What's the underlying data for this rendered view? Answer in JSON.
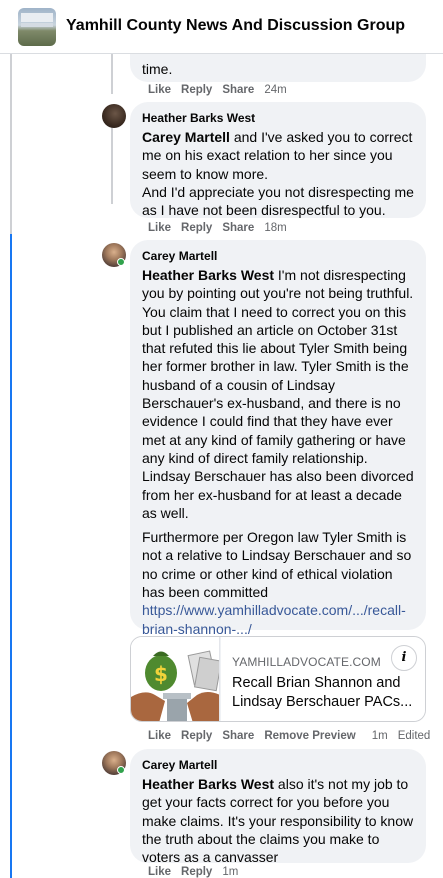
{
  "header": {
    "title": "Yamhill County News And Discussion Group"
  },
  "comments": [
    {
      "author": "",
      "text_tail": "time.",
      "actions": {
        "like": "Like",
        "reply": "Reply",
        "share": "Share",
        "time": "24m"
      }
    },
    {
      "author": "Heather Barks West",
      "mention": "Carey Martell",
      "text": " and I've asked you to correct me on his exact relation to her since you seem to know more.",
      "text2": "And I'd appreciate you not disrespecting me as I have not been disrespectful to you.",
      "actions": {
        "like": "Like",
        "reply": "Reply",
        "share": "Share",
        "time": "18m"
      }
    },
    {
      "author": "Carey Martell",
      "mention": "Heather Barks West",
      "text": " I'm not disrespecting you by pointing out you're not being truthful. You claim that I need to correct you on this but I published an article on October 31st that refuted this lie about Tyler Smith being her former brother in law. Tyler Smith is the husband of a cousin of Lindsay Berschauer's ex-husband, and there is no evidence I could find that they have ever met at any kind of family gathering or have any kind of direct family relationship. Lindsay Berschauer has also been divorced from her ex-husband for at least a decade as well.",
      "text2": "Furthermore per Oregon law Tyler Smith is not a relative to Lindsay Berschauer and so no crime or other kind of ethical violation has been committed",
      "link": "https://www.yamhilladvocate.com/.../recall-brian-shannon-.../",
      "preview": {
        "domain": "YAMHILLADVOCATE.COM",
        "title": "Recall Brian Shannon and Lindsay Berschauer PACs..."
      },
      "actions": {
        "like": "Like",
        "reply": "Reply",
        "share": "Share",
        "remove_preview": "Remove Preview",
        "time": "1m",
        "edited": "Edited"
      }
    },
    {
      "author": "Carey Martell",
      "mention": "Heather Barks West",
      "text": " also it's not my job to get your facts correct for you before you make claims. It's your responsibility to know the truth about the claims you make to voters as a canvasser",
      "actions": {
        "like": "Like",
        "reply": "Reply",
        "time": "1m"
      }
    }
  ],
  "icons": {
    "info": "info-icon",
    "check": "check-icon"
  },
  "colors": {
    "thread_blue": "#1877f2",
    "link": "#385898",
    "bubble": "#f0f2f5"
  }
}
